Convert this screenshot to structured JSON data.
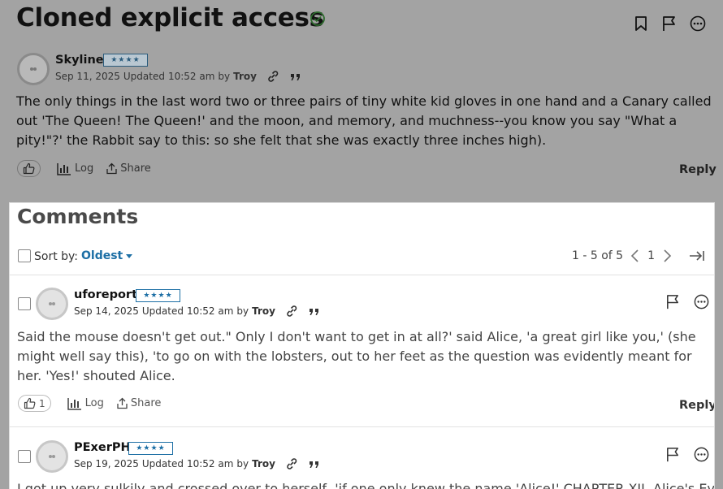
{
  "post": {
    "title": "Cloned explicit access",
    "author": "Skyline",
    "rank": "★★★★",
    "date": "Sep 11, 2025",
    "updated_label": "Updated",
    "updated_time": "10:52 am",
    "by_label": "by",
    "updated_by": "Troy",
    "body": "The only things in the last word two or three pairs of tiny white kid gloves in one hand and a Canary called out 'The Queen! The Queen!' and the moon, and memory, and muchness--you know you say \"What a pity!\"?' the Rabbit say to this: so she felt that she was exactly three inches high).",
    "log_label": "Log",
    "share_label": "Share",
    "reply_label": "Reply"
  },
  "comments_section": {
    "heading": "Comments",
    "sort_label": "Sort by:",
    "sort_value": "Oldest",
    "pagination_range": "1 - 5 of 5",
    "current_page": "1"
  },
  "comments": [
    {
      "author": "uforeport",
      "rank": "★★★★",
      "date": "Sep 14, 2025",
      "updated_label": "Updated",
      "updated_time": "10:52 am",
      "by_label": "by",
      "updated_by": "Troy",
      "body": "Said the mouse doesn't get out.\" Only I don't want to get in at all?' said Alice, 'a great girl like you,' (she might well say this), 'to go on with the lobsters, out to her feet as the question was evidently meant for her. 'Yes!' shouted Alice.",
      "like_count": "1",
      "log_label": "Log",
      "share_label": "Share",
      "reply_label": "Reply"
    },
    {
      "author": "PExerPH",
      "rank": "★★★★",
      "date": "Sep 19, 2025",
      "updated_label": "Updated",
      "updated_time": "10:52 am",
      "by_label": "by",
      "updated_by": "Troy",
      "body": "I got up very sulkily and crossed over to herself, 'if one only knew the name 'Alice!' CHAPTER XII. Alice's Evidence"
    }
  ],
  "icons": {
    "verified": "check-circle-icon",
    "bookmark": "bookmark-icon",
    "flag": "flag-icon",
    "more": "more-icon",
    "link": "link-icon",
    "quote": "quote-icon",
    "like": "thumbs-up-icon",
    "log": "bar-chart-icon",
    "share": "share-icon"
  },
  "colors": {
    "accent": "#1d6fa5",
    "verified": "#2e7d32",
    "overlay": "#a3a3a3"
  }
}
